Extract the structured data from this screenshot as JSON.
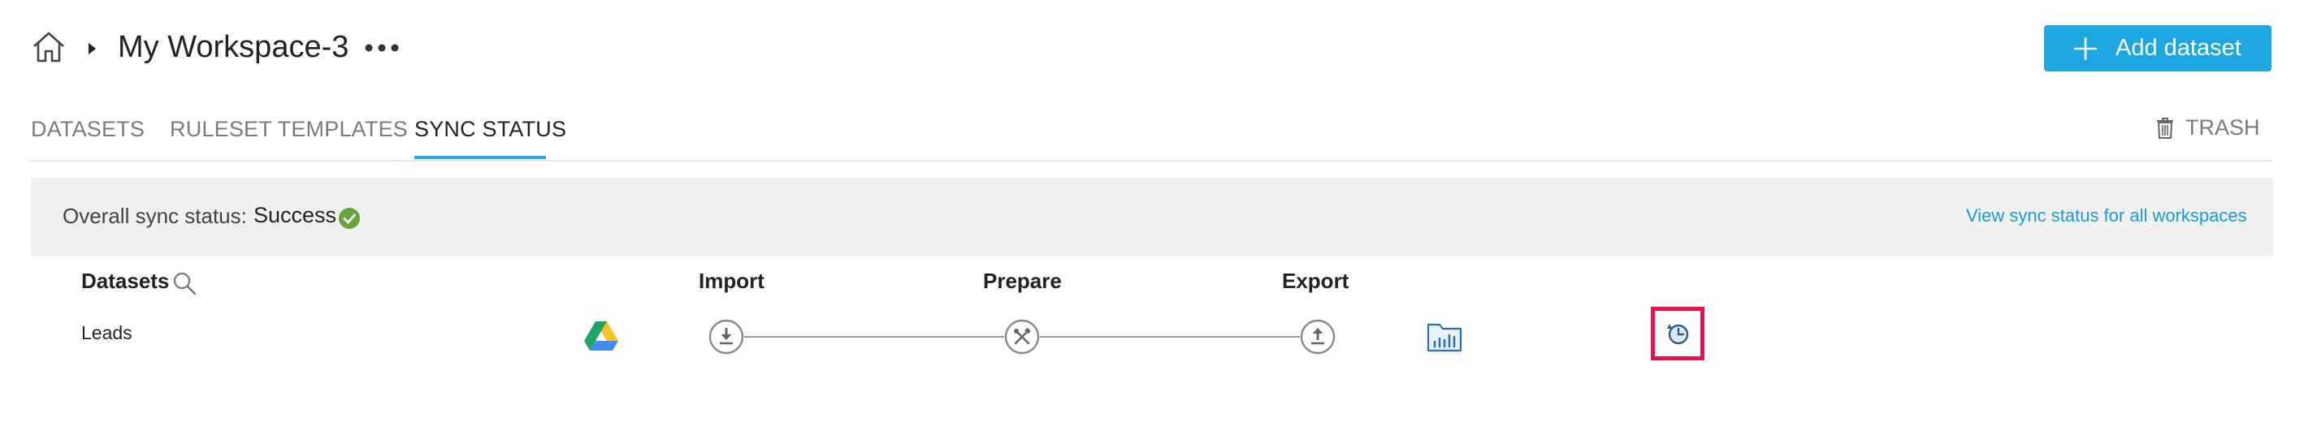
{
  "header": {
    "workspace_title": "My Workspace-3",
    "add_button_label": "Add dataset"
  },
  "tabs": [
    {
      "label": "DATASETS"
    },
    {
      "label": "RULESET TEMPLATES"
    },
    {
      "label": "SYNC STATUS",
      "active": true
    }
  ],
  "trash_label": "TRASH",
  "status": {
    "label": "Overall sync status:",
    "value": "Success",
    "view_all_link": "View sync status for all workspaces"
  },
  "table": {
    "columns": {
      "datasets": "Datasets",
      "import": "Import",
      "prepare": "Prepare",
      "export": "Export"
    },
    "rows": [
      {
        "name": "Leads",
        "source_icon": "google-drive-icon"
      }
    ]
  },
  "colors": {
    "accent": "#1ca7e0",
    "success": "#6aa342",
    "link": "#1a9bd7",
    "highlight": "#e8114e"
  }
}
